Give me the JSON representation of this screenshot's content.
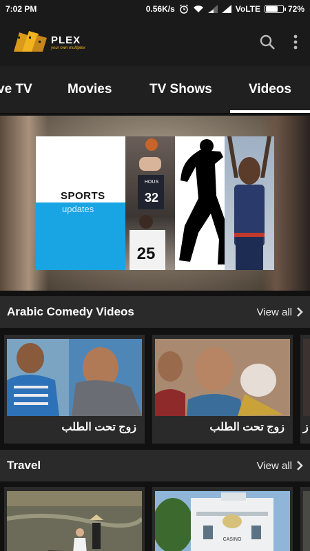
{
  "status": {
    "time": "7:02 PM",
    "speed": "0.56K/s",
    "carrier": "VoLTE",
    "battery": "72%",
    "battery_level": 0.72
  },
  "app": {
    "name": "PLEX",
    "tagline": "your own multiplex",
    "icons": {
      "search": "search-icon",
      "menu": "more-vert-icon"
    }
  },
  "tabs": [
    {
      "label": "ve TV"
    },
    {
      "label": "Movies"
    },
    {
      "label": "TV Shows"
    },
    {
      "label": "Videos",
      "selected": true
    }
  ],
  "banner": {
    "title": "SPORTS",
    "subtitle": "updates",
    "jersey1": "32",
    "jersey2": "25",
    "jersey1_team": "HOUS"
  },
  "sections": [
    {
      "title": "Arabic Comedy Videos",
      "view_all": "View all",
      "items": [
        {
          "caption": "زوج تحت الطلب"
        },
        {
          "caption": "زوج تحت الطلب"
        },
        {
          "caption": "ز"
        }
      ]
    },
    {
      "title": "Travel",
      "view_all": "View all",
      "items": [
        {
          "caption": ""
        },
        {
          "caption": "",
          "sign": "CASINO"
        },
        {
          "caption": ""
        }
      ]
    }
  ],
  "colors": {
    "accent_blue": "#19a4e3",
    "logo_gold": "#f1b320",
    "bar": "#1a1a1a",
    "section": "#2a2a2a"
  }
}
